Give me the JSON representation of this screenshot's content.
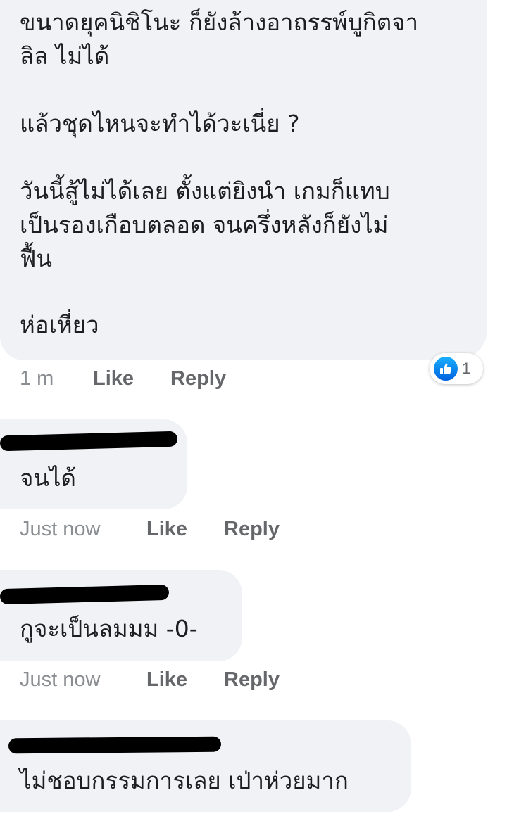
{
  "comments": [
    {
      "lines": [
        "ขนาดยุคนิชิโนะ ก็ยังล้างอาถรรพ์บูกิตจา",
        "ลิล ไม่ได้",
        "",
        "แล้วชุดไหนจะทำได้วะเนี่ย ?",
        "",
        "วันนี้สู้ไม่ได้เลย  ตั้งแต่ยิงนำ เกมก็แทบ",
        "เป็นรองเกือบตลอด จนครึ่งหลังก็ยังไม่",
        "ฟื้น",
        "",
        "ห่อเหี่ยว"
      ],
      "time": "1 m",
      "like_label": "Like",
      "reply_label": "Reply",
      "reaction": {
        "icon": "thumbs-up-icon",
        "count": "1",
        "color": "#1877f2"
      }
    },
    {
      "text": "จนได้",
      "time": "Just now",
      "like_label": "Like",
      "reply_label": "Reply"
    },
    {
      "text": "กูจะเป็นลมมม  -0-",
      "time": "Just now",
      "like_label": "Like",
      "reply_label": "Reply"
    },
    {
      "text": "ไม่ชอบกรรมการเลย เป่าห่วยมาก"
    }
  ],
  "colors": {
    "bubble_bg": "#f0f2f5",
    "meta_text": "#65676b",
    "redaction": "#000000"
  }
}
